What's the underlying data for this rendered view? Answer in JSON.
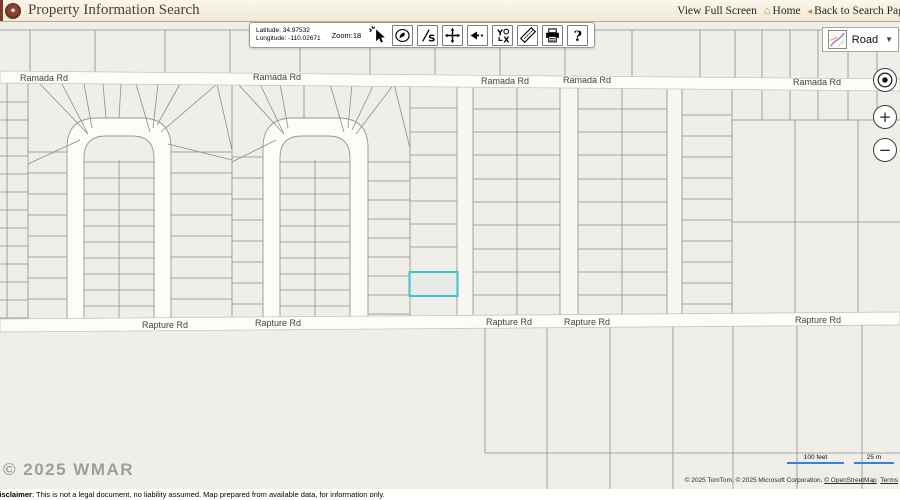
{
  "header": {
    "title": "Property Information Search",
    "links": {
      "view_full_screen": "View Full Screen",
      "home": "Home",
      "back_to_search": "Back to Search Page"
    }
  },
  "toolbar": {
    "latitude": "Latitude: 34.97532",
    "longitude": "Longitude: -110.02671",
    "zoom": "Zoom:18",
    "tools": [
      {
        "name": "identify"
      },
      {
        "name": "overview"
      },
      {
        "name": "scale"
      },
      {
        "name": "pan"
      },
      {
        "name": "previous-extent"
      },
      {
        "name": "xy-coordinates"
      },
      {
        "name": "measure"
      },
      {
        "name": "print"
      },
      {
        "name": "help"
      }
    ]
  },
  "basemap": {
    "selected": "Road"
  },
  "map_controls": {
    "zoom_in": "+",
    "zoom_out": "−"
  },
  "map": {
    "road_labels": {
      "ramada": "Ramada Rd",
      "rapture": "Rapture Rd"
    },
    "highlight_color": "#3fc1ce"
  },
  "scale_bar": {
    "feet": "100 feet",
    "meters": "25 m"
  },
  "attribution": {
    "prefix": "© 2025 TomTom, © 2025 Microsoft Corporation, ",
    "osm": "© OpenStreetMap",
    "terms": "Terms"
  },
  "watermark": "© 2025  WMAR",
  "disclaimer": {
    "label": "Disclaimer",
    "text": ": This is not a legal document, no liability assumed. Map prepared from available data, for information only."
  },
  "colors": {
    "highlight": "#3fc1ce",
    "scalebar_blue": "#3b7fd6",
    "link_accent": "#c8851c",
    "header_maroon": "#7d3b2c"
  }
}
